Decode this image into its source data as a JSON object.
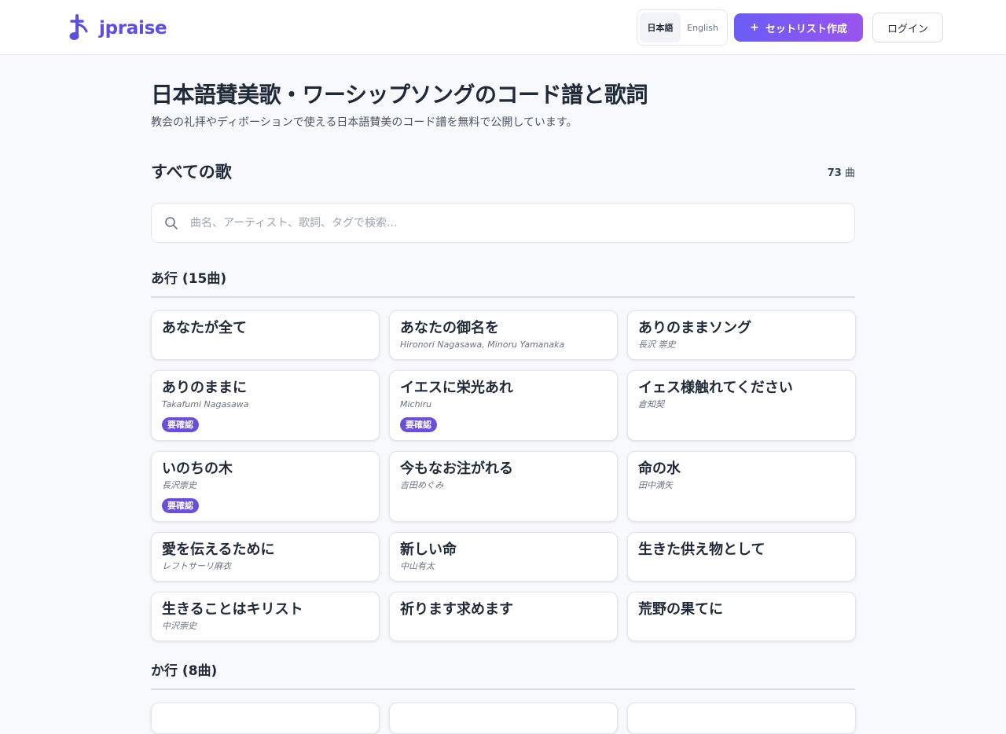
{
  "header": {
    "logo_text": "jpraise",
    "lang_ja": "日本語",
    "lang_en": "English",
    "create_label": "セットリスト作成",
    "login_label": "ログイン"
  },
  "page": {
    "title": "日本語賛美歌・ワーシップソングのコード譜と歌詞",
    "subtitle": "教会の礼拝やディボーションで使える日本語賛美のコード譜を無料で公開しています。"
  },
  "songs_section": {
    "title": "すべての歌",
    "count_number": "73",
    "count_unit": "曲"
  },
  "search": {
    "placeholder": "曲名、アーティスト、歌詞、タグで検索..."
  },
  "groups": [
    {
      "label": "あ行 (15曲)",
      "songs": [
        {
          "title": "あなたが全て",
          "artist": "",
          "badge": ""
        },
        {
          "title": "あなたの御名を",
          "artist": "Hironori Nagasawa, Minoru Yamanaka",
          "badge": ""
        },
        {
          "title": "ありのままソング",
          "artist": "長沢 崇史",
          "badge": ""
        },
        {
          "title": "ありのままに",
          "artist": "Takafumi Nagasawa",
          "badge": "要確認"
        },
        {
          "title": "イエスに栄光あれ",
          "artist": "Michiru",
          "badge": "要確認"
        },
        {
          "title": "イェス様触れてください",
          "artist": "倉知契",
          "badge": ""
        },
        {
          "title": "いのちの木",
          "artist": "長沢崇史",
          "badge": "要確認"
        },
        {
          "title": "今もなお注がれる",
          "artist": "吉田めぐみ",
          "badge": ""
        },
        {
          "title": "命の水",
          "artist": "田中満矢",
          "badge": ""
        },
        {
          "title": "愛を伝えるために",
          "artist": "レフトサーリ麻衣",
          "badge": ""
        },
        {
          "title": "新しい命",
          "artist": "中山有太",
          "badge": ""
        },
        {
          "title": "生きた供え物として",
          "artist": "",
          "badge": ""
        },
        {
          "title": "生きることはキリスト",
          "artist": "中沢崇史",
          "badge": ""
        },
        {
          "title": "祈ります求めます",
          "artist": "",
          "badge": ""
        },
        {
          "title": "荒野の果てに",
          "artist": "",
          "badge": ""
        }
      ]
    },
    {
      "label": "か行 (8曲)",
      "songs": []
    }
  ],
  "colors": {
    "brand": "#5b4ee0",
    "gradient_start": "#6a5cf5",
    "gradient_end": "#9b54ef",
    "badge": "#6b4fd8",
    "page_bg": "#f7f9fc"
  }
}
